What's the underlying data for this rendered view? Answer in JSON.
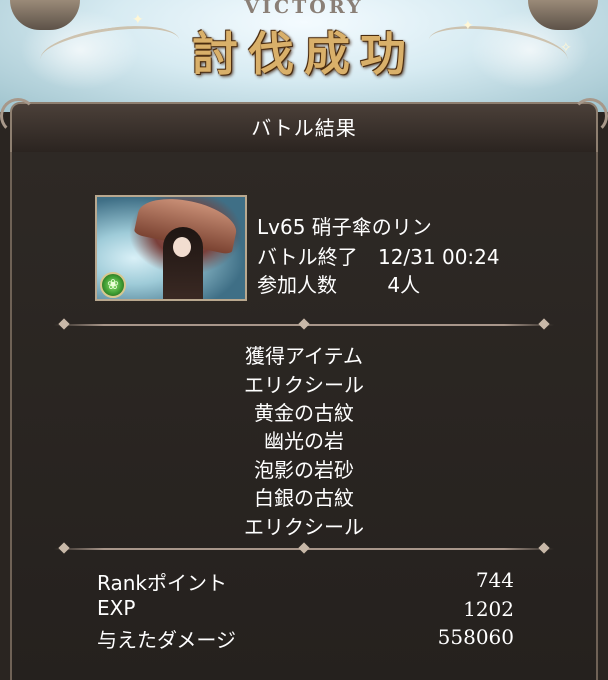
{
  "header": {
    "victory_label": "VICTORY",
    "title": "討伐成功"
  },
  "panel": {
    "title": "バトル結果"
  },
  "quest": {
    "name": "Lv65 硝子傘のリン",
    "battle_end_label": "バトル終了",
    "battle_end_time": "12/31 00:24",
    "participants_label": "参加人数",
    "participants_value": "4人",
    "element_icon": "wind-element-icon",
    "element_color": "#4caf3a"
  },
  "items": {
    "heading": "獲得アイテム",
    "list": [
      "エリクシール",
      "黄金の古紋",
      "幽光の岩",
      "泡影の岩砂",
      "白銀の古紋",
      "エリクシール"
    ]
  },
  "results": {
    "rank_label": "Rankポイント",
    "rank_value": "744",
    "exp_label": "EXP",
    "exp_value": "1202",
    "damage_label": "与えたダメージ",
    "damage_value": "558060"
  },
  "colors": {
    "title_gold": "#d9b06a",
    "panel_bg": "#2a2521",
    "frame": "#8e7f70"
  }
}
